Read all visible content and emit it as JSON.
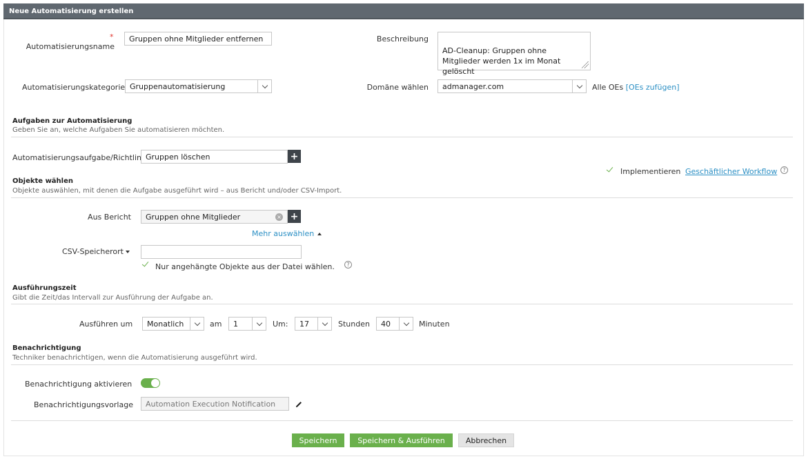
{
  "window": {
    "title": "Neue Automatisierung erstellen"
  },
  "general": {
    "name_label": "Automatisierungsname",
    "required_mark": "*",
    "name_value": "Gruppen ohne Mitglieder entfernen",
    "description_label": "Beschreibung",
    "description_value": "AD-Cleanup: Gruppen ohne\nMitglieder werden 1x im Monat\ngelöscht",
    "category_label": "Automatisierungskategorie",
    "category_value": "Gruppenautomatisierung",
    "domain_label": "Domäne wählen",
    "domain_value": "admanager.com",
    "all_ous_text": "Alle OEs",
    "add_ous_link": "[OEs zufügen]"
  },
  "tasks": {
    "title": "Aufgaben zur Automatisierung",
    "subtitle": "Geben Sie an, welche Aufgaben Sie automatisieren möchten.",
    "task_label": "Automatisierungsaufgabe/Richtlin",
    "task_value": "Gruppen löschen",
    "implement_label": "Implementieren",
    "workflow_link": "Geschäftlicher Workflow"
  },
  "objects": {
    "title": "Objekte wählen",
    "subtitle": "Objekte auswählen, mit denen die Aufgabe ausgeführt wird – aus Bericht und/oder CSV-Import.",
    "report_label": "Aus Bericht",
    "report_value": "Gruppen ohne Mitglieder",
    "more_select": "Mehr auswählen",
    "csv_label": "CSV-Speicherort",
    "csv_value": "",
    "attached_only_label": "Nur angehängte Objekte aus der Datei wählen."
  },
  "schedule": {
    "title": "Ausführungszeit",
    "subtitle": "Gibt die Zeit/das Intervall zur Ausführung der Aufgabe an.",
    "run_at_label": "Ausführen um",
    "frequency_value": "Monatlich",
    "on_label": "am",
    "day_value": "1",
    "at_label": "Um:",
    "hour_value": "17",
    "hours_label": "Stunden",
    "minute_value": "40",
    "minutes_label": "Minuten"
  },
  "notification": {
    "title": "Benachrichtigung",
    "subtitle": "Techniker benachrichtigen, wenn die Automatisierung ausgeführt wird.",
    "enable_label": "Benachrichtigung aktivieren",
    "enabled": true,
    "template_label": "Benachrichtigungsvorlage",
    "template_value": "Automation Execution Notification"
  },
  "actions": {
    "save": "Speichern",
    "save_run": "Speichern & Ausführen",
    "cancel": "Abbrechen"
  },
  "colors": {
    "titlebar": "#606870",
    "accent_green": "#6ab04c",
    "link": "#2b8fc4",
    "required": "#e0322b"
  }
}
